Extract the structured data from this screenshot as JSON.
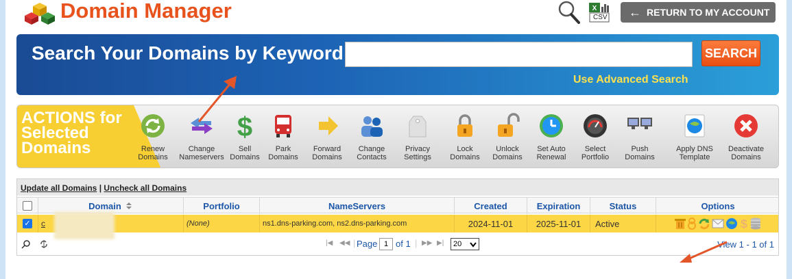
{
  "header": {
    "title": "Domain Manager",
    "logo_icon": "colored-cubes-icon",
    "export_csv_label": "CSV",
    "return_button_label": "RETURN TO MY ACCOUNT"
  },
  "search": {
    "title": "Search Your Domains by Keyword",
    "input_value": "",
    "button_label": "SEARCH",
    "advanced_link": "Use Advanced Search"
  },
  "actions": {
    "label_line1": "ACTIONS for",
    "label_line2": "Selected",
    "label_line3": "Domains",
    "items": [
      {
        "label1": "Renew",
        "label2": "Domains",
        "icon": "renew-icon"
      },
      {
        "label1": "Change",
        "label2": "Nameservers",
        "icon": "nameservers-arrows-icon"
      },
      {
        "label1": "Sell",
        "label2": "Domains",
        "icon": "dollar-icon"
      },
      {
        "label1": "Park",
        "label2": "Domains",
        "icon": "bus-icon"
      },
      {
        "label1": "Forward",
        "label2": "Domains",
        "icon": "forward-arrow-icon"
      },
      {
        "label1": "Change",
        "label2": "Contacts",
        "icon": "contacts-icon"
      },
      {
        "label1": "Privacy",
        "label2": "Settings",
        "icon": "privacy-tag-icon"
      },
      {
        "label1": "Lock",
        "label2": "Domains",
        "icon": "lock-icon"
      },
      {
        "label1": "Unlock",
        "label2": "Domains",
        "icon": "unlock-icon"
      },
      {
        "label1": "Set Auto",
        "label2": "Renewal",
        "icon": "clock-icon"
      },
      {
        "label1": "Select",
        "label2": "Portfolio",
        "icon": "portfolio-gauge-icon"
      },
      {
        "label1": "Push",
        "label2": "Domains",
        "icon": "push-computers-icon"
      },
      {
        "label1": "Apply DNS",
        "label2": "Template",
        "icon": "dns-globe-icon"
      },
      {
        "label1": "Deactivate",
        "label2": "Domains",
        "icon": "deactivate-x-icon"
      }
    ]
  },
  "grid": {
    "update_all": "Update all Domains",
    "separator": "|",
    "uncheck_all": "Uncheck all Domains",
    "columns": {
      "domain": "Domain",
      "sort_icon": "sort-icon",
      "portfolio": "Portfolio",
      "nameservers": "NameServers",
      "created": "Created",
      "expiration": "Expiration",
      "status": "Status",
      "options": "Options"
    },
    "rows": [
      {
        "checked": true,
        "domain": "c",
        "portfolio": "(None)",
        "nameservers": "ns1.dns-parking.com, ns2.dns-parking.com",
        "created": "2024-11-01",
        "expiration": "2025-11-01",
        "status": "Active"
      }
    ],
    "pager": {
      "page_label": "Page",
      "page_value": "1",
      "of_label": "of 1",
      "page_size": "20",
      "view_text": "View 1 - 1 of 1"
    }
  },
  "colors": {
    "title_orange": "#e8531d",
    "banner_blue": "#1d63b5",
    "actions_yellow": "#f8cf32",
    "row_highlight": "#fcd644",
    "link_blue": "#1c56a8",
    "annotation_arrow": "#e3562a"
  }
}
